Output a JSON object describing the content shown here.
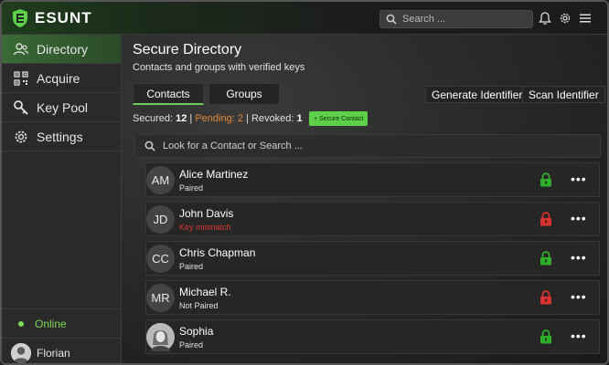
{
  "app": {
    "name": "ESUNT",
    "search_placeholder": "Search ...",
    "brand_color": "#5fd04a"
  },
  "sidebar": {
    "items": [
      {
        "label": "Directory",
        "icon": "users-icon",
        "active": true
      },
      {
        "label": "Acquire",
        "icon": "qr-code-icon",
        "active": false
      },
      {
        "label": "Key Pool",
        "icon": "key-icon",
        "active": false
      },
      {
        "label": "Settings",
        "icon": "gear-icon",
        "active": false
      }
    ],
    "status": "Online",
    "user": "Florian"
  },
  "main": {
    "title": "Secure Directory",
    "subtitle": "Contacts and groups with verified keys",
    "tabs": [
      {
        "label": "Contacts",
        "active": true
      },
      {
        "label": "Groups",
        "active": false
      }
    ],
    "actions": {
      "generate": "Generate Identifier",
      "scan": "Scan Identifier"
    },
    "stats": {
      "secured_label": "Secured:",
      "secured": "12",
      "pending_label": "Pending:",
      "pending": "2",
      "revoked_label": "Revoked:",
      "revoked": "1"
    },
    "secure_contact_button": "+ Secure Contact",
    "contact_search_placeholder": "Look for a Contact or Search ...",
    "contacts": [
      {
        "initials": "AM",
        "name": "Alice Martinez",
        "status": "Paired",
        "lock": "green"
      },
      {
        "initials": "JD",
        "name": "John Davis",
        "status": "Key mismatch",
        "lock": "red"
      },
      {
        "initials": "CC",
        "name": "Chris Chapman",
        "status": "Paired",
        "lock": "green"
      },
      {
        "initials": "MR",
        "name": "Michael R.",
        "status": "Not Paired",
        "lock": "red"
      },
      {
        "initials": "",
        "name": "Sophia",
        "status": "Paired",
        "lock": "green"
      }
    ]
  },
  "colors": {
    "lock_green": "#2fae2a",
    "lock_red": "#d93030",
    "pending": "#e0873a",
    "error": "#e03535"
  }
}
